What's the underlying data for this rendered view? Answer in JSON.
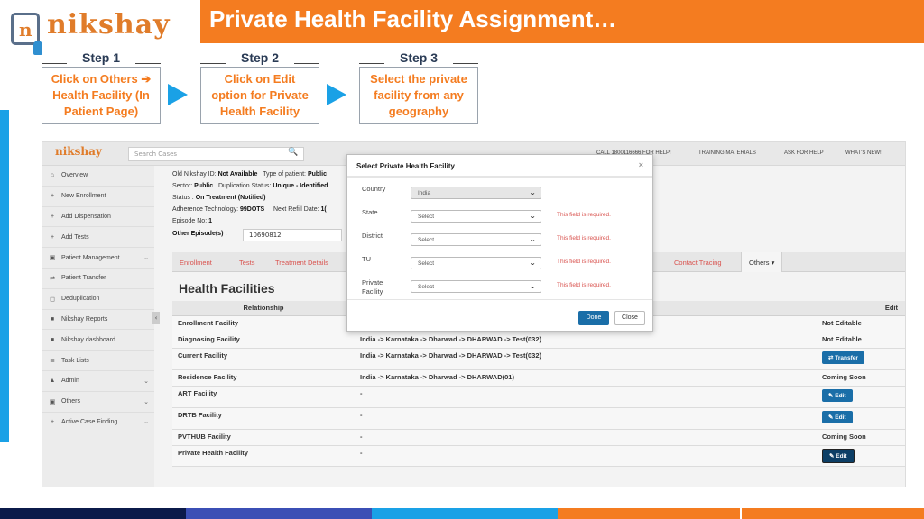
{
  "header": {
    "logo_text": "nikshay",
    "logo_letter": "n",
    "title": "Private Health Facility Assignment…"
  },
  "steps": [
    {
      "label": "Step 1",
      "text": "Click on Others ➔ Health Facility (In Patient Page)"
    },
    {
      "label": "Step 2",
      "text": "Click on Edit option for Private Health Facility"
    },
    {
      "label": "Step 3",
      "text": "Select the private facility from any geography"
    }
  ],
  "app": {
    "logo": "nikshay",
    "search_placeholder": "Search Cases",
    "nav": [
      "CALL 1800116666 FOR HELP!",
      "TRAINING MATERIALS",
      "ASK FOR HELP",
      "WHAT'S NEW!"
    ],
    "sidebar": [
      {
        "label": "Overview",
        "icon": "⌂",
        "chev": ""
      },
      {
        "label": "New Enrollment",
        "icon": "+",
        "chev": ""
      },
      {
        "label": "Add Dispensation",
        "icon": "+",
        "chev": ""
      },
      {
        "label": "Add Tests",
        "icon": "+",
        "chev": ""
      },
      {
        "label": "Patient Management",
        "icon": "▣",
        "chev": "⌄"
      },
      {
        "label": "Patient Transfer",
        "icon": "⇄",
        "chev": ""
      },
      {
        "label": "Deduplication",
        "icon": "◻",
        "chev": ""
      },
      {
        "label": "Nikshay Reports",
        "icon": "■",
        "chev": ""
      },
      {
        "label": "Nikshay dashboard",
        "icon": "■",
        "chev": ""
      },
      {
        "label": "Task Lists",
        "icon": "≣",
        "chev": ""
      },
      {
        "label": "Admin",
        "icon": "▲",
        "chev": "⌄"
      },
      {
        "label": "Others",
        "icon": "▣",
        "chev": "⌄"
      },
      {
        "label": "Active Case Finding",
        "icon": "+",
        "chev": "⌄"
      }
    ],
    "info": {
      "line1_a": "Old Nikshay ID:",
      "line1_b": "Not Available",
      "line1_c": "Type of patient:",
      "line1_d": "Public",
      "line2_a": "Sector:",
      "line2_b": "Public",
      "line2_c": "Duplication Status:",
      "line2_d": "Unique - Identified",
      "line3_a": "Status :",
      "line3_b": "On Treatment (Notified)",
      "line4_a": "Adherence Technology:",
      "line4_b": "99DOTS",
      "line4_c": "Next Refill Date:",
      "line4_d": "1(",
      "line5_a": "Episode No:",
      "line5_b": "1",
      "line6_a": "Other Episode(s) :",
      "episode_value": "10690812"
    },
    "tabs": [
      "Enrollment",
      "Tests",
      "Treatment Details",
      "Contact Tracing",
      "Others ▾"
    ],
    "hf_title": "Health Facilities",
    "table": {
      "headers": [
        "Relationship",
        "",
        "Edit"
      ],
      "rows": [
        {
          "rel": "Enrollment Facility",
          "loc": "",
          "edit": "Not Editable",
          "type": "text"
        },
        {
          "rel": "Diagnosing Facility",
          "loc": "India -> Karnataka -> Dharwad -> DHARWAD -> Test(032)",
          "edit": "Not Editable",
          "type": "text"
        },
        {
          "rel": "Current Facility",
          "loc": "India -> Karnataka -> Dharwad -> DHARWAD -> Test(032)",
          "edit": "⇄ Transfer",
          "type": "btn"
        },
        {
          "rel": "Residence Facility",
          "loc": "India -> Karnataka -> Dharwad -> DHARWAD(01)",
          "edit": "Coming Soon",
          "type": "text"
        },
        {
          "rel": "ART Facility",
          "loc": "-",
          "edit": "✎ Edit",
          "type": "btn"
        },
        {
          "rel": "DRTB Facility",
          "loc": "-",
          "edit": "✎ Edit",
          "type": "btn"
        },
        {
          "rel": "PVTHUB Facility",
          "loc": "-",
          "edit": "Coming Soon",
          "type": "text"
        },
        {
          "rel": "Private Health Facility",
          "loc": "-",
          "edit": "✎ Edit",
          "type": "btn-dark"
        }
      ]
    }
  },
  "modal": {
    "title": "Select Private Health Facility",
    "close_icon": "×",
    "fields": [
      {
        "label": "Country",
        "value": "India",
        "error": "",
        "disabled": true
      },
      {
        "label": "State",
        "value": "Select",
        "error": "This field is required.",
        "disabled": false
      },
      {
        "label": "District",
        "value": "Select",
        "error": "This field is required.",
        "disabled": false
      },
      {
        "label": "TU",
        "value": "Select",
        "error": "This field is required.",
        "disabled": false
      },
      {
        "label": "Private Facility",
        "value": "Select",
        "error": "This field is required.",
        "disabled": false
      }
    ],
    "done": "Done",
    "close": "Close"
  },
  "colors": {
    "brand_orange": "#f47c20",
    "accent_blue": "#1aa1e6",
    "footer": [
      "#0b1a4a",
      "#3b4fb5",
      "#1aa1e6",
      "#f47c20",
      "#f47c20"
    ]
  }
}
